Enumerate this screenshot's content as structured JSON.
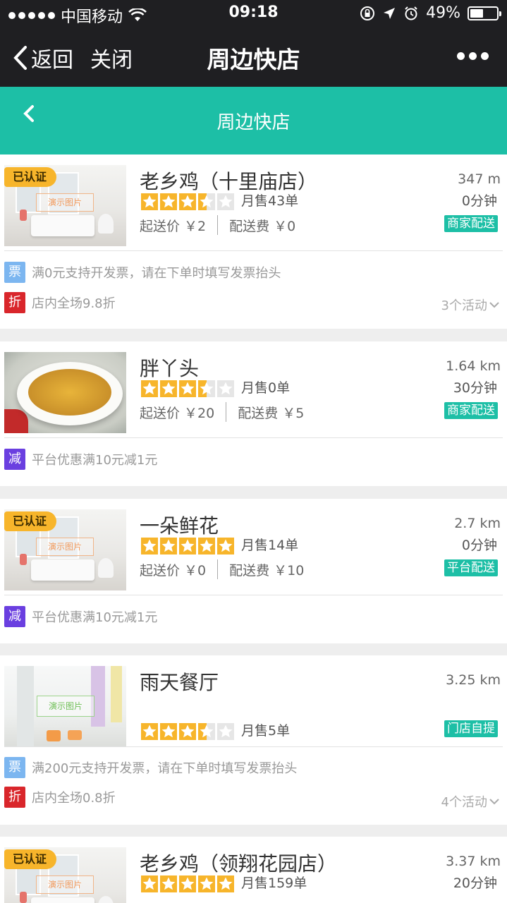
{
  "status_bar": {
    "carrier": "中国移动",
    "time": "09:18",
    "battery_text": "49%",
    "battery_level": 0.49
  },
  "navbar": {
    "back_label": "返回",
    "close_label": "关闭",
    "title": "周边快店"
  },
  "header": {
    "title": "周边快店"
  },
  "colors": {
    "accent": "#1dbfa6",
    "nav_bg": "#1f1f22",
    "star": "#f7b52b",
    "tag_invoice": "#7cb6f0",
    "tag_discount": "#d9262b",
    "tag_reduce": "#6a3fe0"
  },
  "stores": [
    {
      "certified_label": "已认证",
      "image_watermark": "演示图片",
      "name": "老乡鸡（十里庙店）",
      "distance": "347 m",
      "rating": 3.5,
      "monthly_sales": "月售43单",
      "delivery_time": "0分钟",
      "min_order": "起送价 ￥2",
      "delivery_fee": "配送费 ￥0",
      "delivery_type": "商家配送",
      "promos": [
        {
          "tag": "票",
          "text": "满0元支持开发票，请在下单时填写发票抬头"
        },
        {
          "tag": "折",
          "text": "店内全场9.8折"
        }
      ],
      "activity_count": "3个活动"
    },
    {
      "name": "胖丫头",
      "distance": "1.64 km",
      "rating": 3.5,
      "monthly_sales": "月售0单",
      "delivery_time": "30分钟",
      "min_order": "起送价 ￥20",
      "delivery_fee": "配送费 ￥5",
      "delivery_type": "商家配送",
      "promos": [
        {
          "tag": "减",
          "text": "平台优惠满10元减1元"
        }
      ]
    },
    {
      "certified_label": "已认证",
      "image_watermark": "演示图片",
      "name": "一朵鲜花",
      "distance": "2.7 km",
      "rating": 5,
      "monthly_sales": "月售14单",
      "delivery_time": "0分钟",
      "min_order": "起送价 ￥0",
      "delivery_fee": "配送费 ￥10",
      "delivery_type": "平台配送",
      "promos": [
        {
          "tag": "减",
          "text": "平台优惠满10元减1元"
        }
      ]
    },
    {
      "image_watermark": "演示图片",
      "name": "雨天餐厅",
      "distance": "3.25 km",
      "rating": 3.5,
      "monthly_sales": "月售5单",
      "delivery_type": "门店自提",
      "promos": [
        {
          "tag": "票",
          "text": "满200元支持开发票，请在下单时填写发票抬头"
        },
        {
          "tag": "折",
          "text": "店内全场0.8折"
        }
      ],
      "activity_count": "4个活动"
    },
    {
      "certified_label": "已认证",
      "image_watermark": "演示图片",
      "name": "老乡鸡（领翔花园店）",
      "distance": "3.37 km",
      "rating": 5,
      "monthly_sales": "月售159单",
      "delivery_time": "20分钟"
    }
  ]
}
